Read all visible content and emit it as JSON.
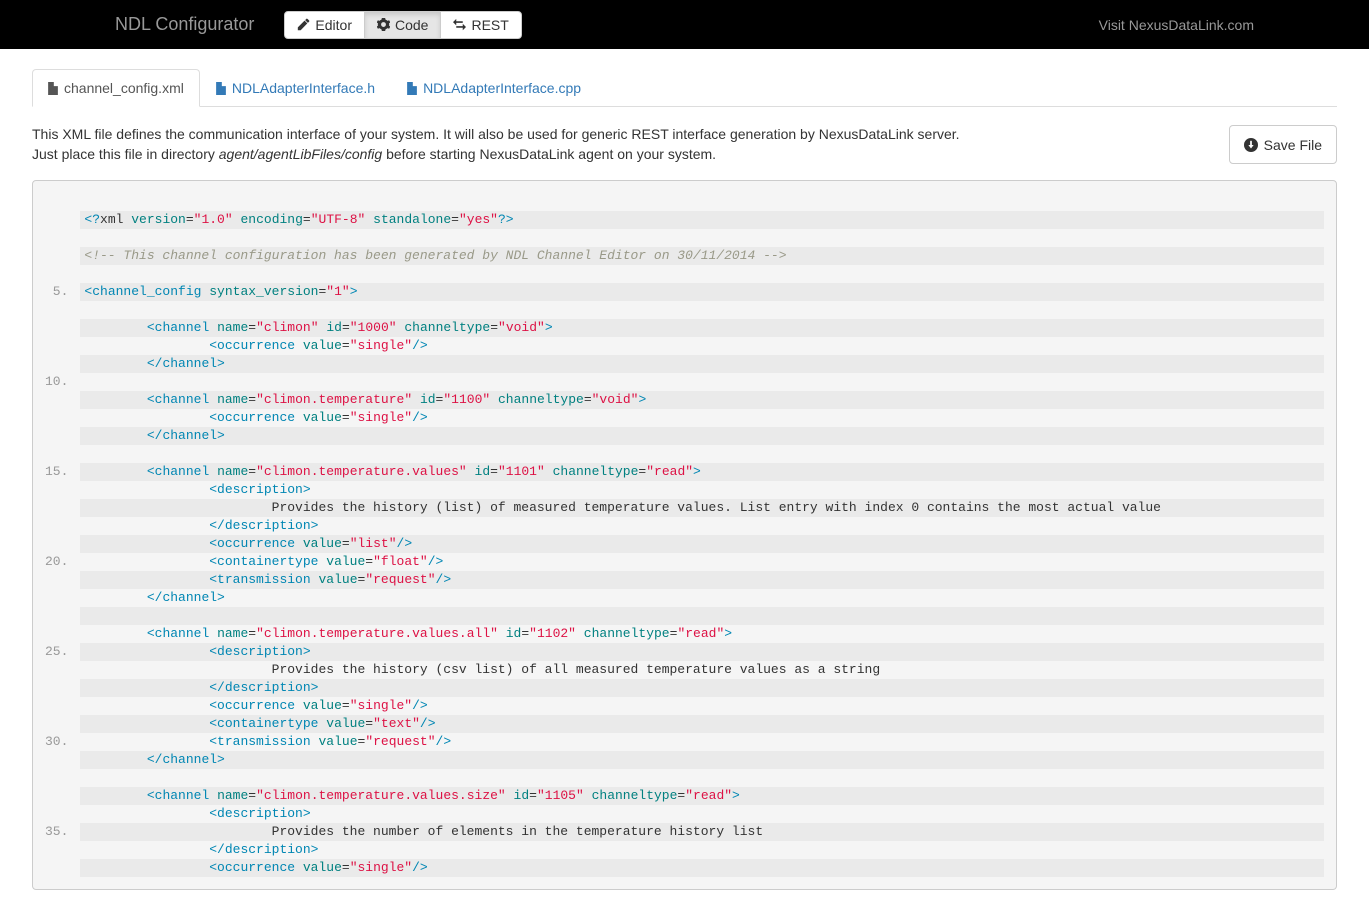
{
  "navbar": {
    "brand": "NDL Configurator",
    "buttons": [
      {
        "label": "Editor",
        "icon": "pencil-icon"
      },
      {
        "label": "Code",
        "icon": "cog-icon"
      },
      {
        "label": "REST",
        "icon": "transfer-icon"
      }
    ],
    "visit_label": "Visit NexusDataLink.com"
  },
  "tabs": [
    {
      "label": "channel_config.xml"
    },
    {
      "label": "NDLAdapterInterface.h"
    },
    {
      "label": "NDLAdapterInterface.cpp"
    }
  ],
  "description": {
    "line1": "This XML file defines the communication interface of your system. It will also be used for generic REST interface generation by NexusDataLink server.",
    "line2a": "Just place this file in directory ",
    "line2em": "agent/agentLibFiles/config",
    "line2b": " before starting NexusDataLink agent on your system."
  },
  "save_label": "Save File",
  "line_markers": [
    "5.",
    "10.",
    "15.",
    "20.",
    "25.",
    "30.",
    "35."
  ],
  "code_lines": [
    {
      "t": "pi",
      "piName": "xml",
      "attrs": [
        [
          "version",
          "\"1.0\""
        ],
        [
          "encoding",
          "\"UTF-8\""
        ],
        [
          "standalone",
          "\"yes\""
        ]
      ]
    },
    {
      "t": "blank"
    },
    {
      "t": "comment",
      "text": "<!-- This channel configuration has been generated by NDL Channel Editor on 30/11/2014 -->"
    },
    {
      "t": "blank"
    },
    {
      "t": "open",
      "indent": 0,
      "name": "channel_config",
      "attrs": [
        [
          "syntax_version",
          "\"1\""
        ]
      ],
      "self": false
    },
    {
      "t": "blank"
    },
    {
      "t": "open",
      "indent": 8,
      "name": "channel",
      "attrs": [
        [
          "name",
          "\"climon\""
        ],
        [
          "id",
          "\"1000\""
        ],
        [
          "channeltype",
          "\"void\""
        ]
      ],
      "self": false
    },
    {
      "t": "open",
      "indent": 16,
      "name": "occurrence",
      "attrs": [
        [
          "value",
          "\"single\""
        ]
      ],
      "self": true
    },
    {
      "t": "close",
      "indent": 8,
      "name": "channel"
    },
    {
      "t": "blank"
    },
    {
      "t": "open",
      "indent": 8,
      "name": "channel",
      "attrs": [
        [
          "name",
          "\"climon.temperature\""
        ],
        [
          "id",
          "\"1100\""
        ],
        [
          "channeltype",
          "\"void\""
        ]
      ],
      "self": false
    },
    {
      "t": "open",
      "indent": 16,
      "name": "occurrence",
      "attrs": [
        [
          "value",
          "\"single\""
        ]
      ],
      "self": true
    },
    {
      "t": "close",
      "indent": 8,
      "name": "channel"
    },
    {
      "t": "blank"
    },
    {
      "t": "open",
      "indent": 8,
      "name": "channel",
      "attrs": [
        [
          "name",
          "\"climon.temperature.values\""
        ],
        [
          "id",
          "\"1101\""
        ],
        [
          "channeltype",
          "\"read\""
        ]
      ],
      "self": false
    },
    {
      "t": "open",
      "indent": 16,
      "name": "description",
      "attrs": [],
      "self": false
    },
    {
      "t": "text",
      "indent": 24,
      "text": "Provides the history (list) of measured temperature values. List entry with index 0 contains the most actual value"
    },
    {
      "t": "close",
      "indent": 16,
      "name": "description"
    },
    {
      "t": "open",
      "indent": 16,
      "name": "occurrence",
      "attrs": [
        [
          "value",
          "\"list\""
        ]
      ],
      "self": true
    },
    {
      "t": "open",
      "indent": 16,
      "name": "containertype",
      "attrs": [
        [
          "value",
          "\"float\""
        ]
      ],
      "self": true
    },
    {
      "t": "open",
      "indent": 16,
      "name": "transmission",
      "attrs": [
        [
          "value",
          "\"request\""
        ]
      ],
      "self": true
    },
    {
      "t": "close",
      "indent": 8,
      "name": "channel"
    },
    {
      "t": "blank"
    },
    {
      "t": "open",
      "indent": 8,
      "name": "channel",
      "attrs": [
        [
          "name",
          "\"climon.temperature.values.all\""
        ],
        [
          "id",
          "\"1102\""
        ],
        [
          "channeltype",
          "\"read\""
        ]
      ],
      "self": false
    },
    {
      "t": "open",
      "indent": 16,
      "name": "description",
      "attrs": [],
      "self": false
    },
    {
      "t": "text",
      "indent": 24,
      "text": "Provides the history (csv list) of all measured temperature values as a string"
    },
    {
      "t": "close",
      "indent": 16,
      "name": "description"
    },
    {
      "t": "open",
      "indent": 16,
      "name": "occurrence",
      "attrs": [
        [
          "value",
          "\"single\""
        ]
      ],
      "self": true
    },
    {
      "t": "open",
      "indent": 16,
      "name": "containertype",
      "attrs": [
        [
          "value",
          "\"text\""
        ]
      ],
      "self": true
    },
    {
      "t": "open",
      "indent": 16,
      "name": "transmission",
      "attrs": [
        [
          "value",
          "\"request\""
        ]
      ],
      "self": true
    },
    {
      "t": "close",
      "indent": 8,
      "name": "channel"
    },
    {
      "t": "blank"
    },
    {
      "t": "open",
      "indent": 8,
      "name": "channel",
      "attrs": [
        [
          "name",
          "\"climon.temperature.values.size\""
        ],
        [
          "id",
          "\"1105\""
        ],
        [
          "channeltype",
          "\"read\""
        ]
      ],
      "self": false
    },
    {
      "t": "open",
      "indent": 16,
      "name": "description",
      "attrs": [],
      "self": false
    },
    {
      "t": "text",
      "indent": 24,
      "text": "Provides the number of elements in the temperature history list"
    },
    {
      "t": "close",
      "indent": 16,
      "name": "description"
    },
    {
      "t": "open",
      "indent": 16,
      "name": "occurrence",
      "attrs": [
        [
          "value",
          "\"single\""
        ]
      ],
      "self": true
    }
  ]
}
